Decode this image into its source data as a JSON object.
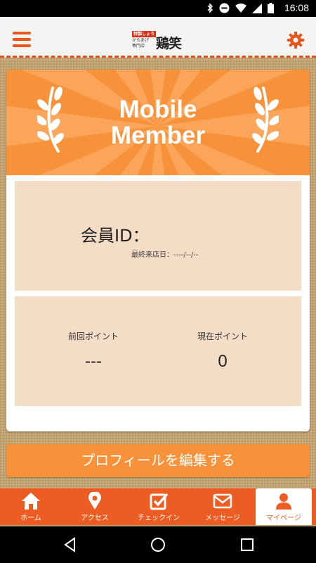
{
  "status_bar": {
    "time": "16:08"
  },
  "header": {
    "logo_badge": "特製しょうゆ",
    "logo_sub_1": "からあげ",
    "logo_sub_2": "専門店",
    "logo_name": "鶏笑"
  },
  "card": {
    "banner_title_1": "Mobile",
    "banner_title_2": "Member",
    "member_id_label": "会員ID：",
    "last_visit": "最終来店日：----/--/--",
    "points": {
      "previous_label": "前回ポイント",
      "previous_value": "---",
      "current_label": "現在ポイント",
      "current_value": "0"
    }
  },
  "edit_profile_label": "プロフィールを編集する",
  "tabs": [
    {
      "label": "ホーム",
      "icon": "home-icon"
    },
    {
      "label": "アクセス",
      "icon": "map-pin-icon"
    },
    {
      "label": "チェックイン",
      "icon": "checkbox-icon"
    },
    {
      "label": "メッセージ",
      "icon": "envelope-icon"
    },
    {
      "label": "マイページ",
      "icon": "person-icon",
      "active": true
    }
  ],
  "colors": {
    "accent": "#f7923a",
    "tabbar": "#ed5c22",
    "panel": "#f5dcc6"
  }
}
